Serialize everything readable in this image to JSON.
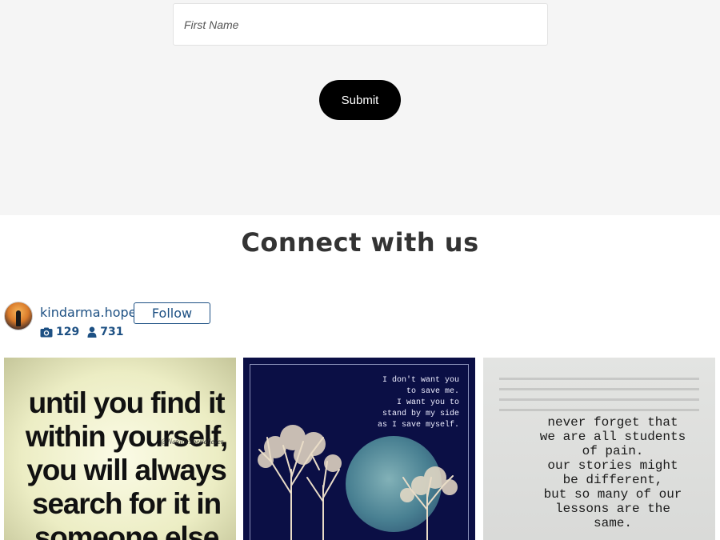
{
  "form": {
    "first_name_placeholder": "First Name",
    "submit_label": "Submit"
  },
  "connect": {
    "title": "Connect with us"
  },
  "profile": {
    "username": "kindarma.hope",
    "follow_label": "Follow",
    "posts_count": "129",
    "followers_count": "731",
    "posts_icon": "camera-icon",
    "followers_icon": "user-icon"
  },
  "gallery": {
    "tiles": [
      {
        "quote": "until you find it\nwithin yourself,\nyou will always\nsearch for it in\nsomeone else",
        "signature": "@NatalieTheBeliever"
      },
      {
        "quote": "I don't want you\nto save me.\nI want you to\nstand by my side\nas I save myself."
      },
      {
        "quote": "never forget that\nwe are all students\nof pain.\nour stories might\nbe different,\nbut so many of our\nlessons are the\nsame."
      }
    ]
  },
  "colors": {
    "accent": "#1d5083",
    "form_bg": "#f5f5f5",
    "button_bg": "#000000"
  }
}
